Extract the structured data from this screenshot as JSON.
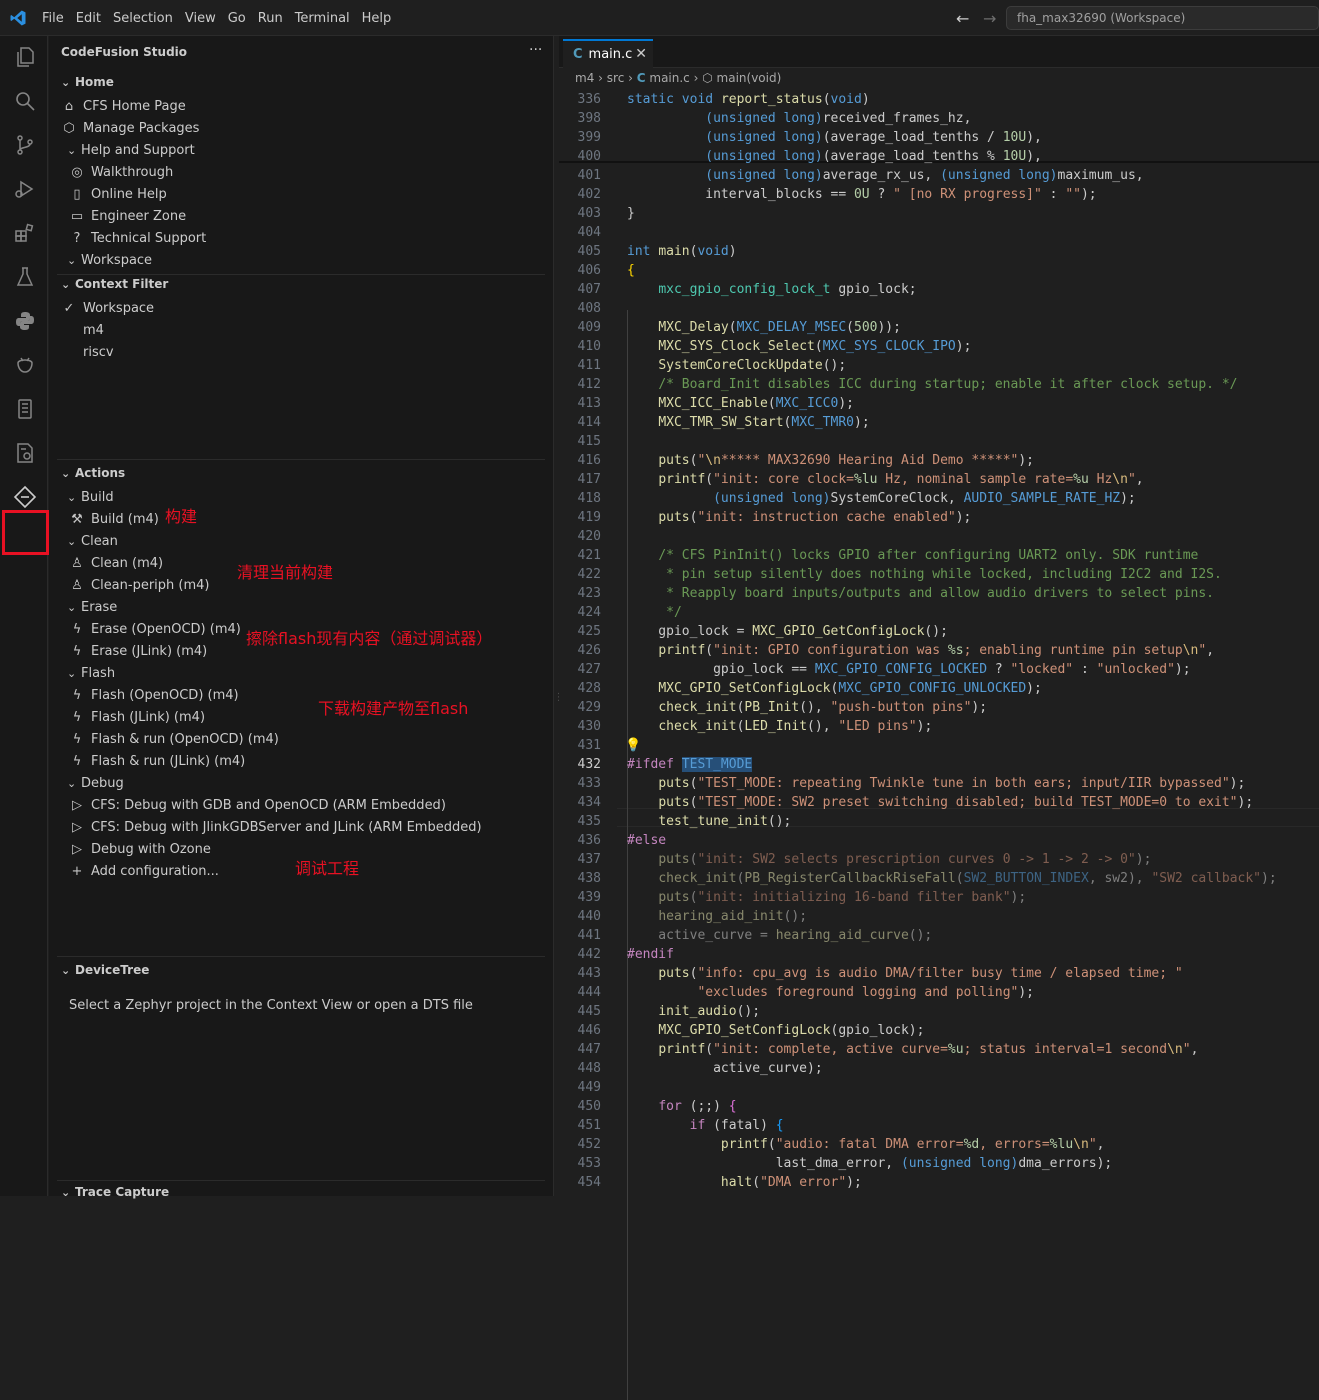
{
  "menu": [
    "File",
    "Edit",
    "Selection",
    "View",
    "Go",
    "Run",
    "Terminal",
    "Help"
  ],
  "workspace_search": "fha_max32690 (Workspace)",
  "sidebar": {
    "title": "CodeFusion Studio",
    "home_header": "Home",
    "home_items": [
      "CFS Home Page",
      "Manage Packages"
    ],
    "help_header": "Help and Support",
    "help_items": [
      "Walkthrough",
      "Online Help",
      "Engineer Zone",
      "Technical Support"
    ],
    "workspace_header": "Workspace",
    "context_header": "Context Filter",
    "context_items": [
      "Workspace",
      "m4",
      "riscv"
    ],
    "actions_header": "Actions",
    "build_header": "Build",
    "build_items": [
      "Build (m4)"
    ],
    "clean_header": "Clean",
    "clean_items": [
      "Clean (m4)",
      "Clean-periph (m4)"
    ],
    "erase_header": "Erase",
    "erase_items": [
      "Erase (OpenOCD) (m4)",
      "Erase (JLink) (m4)"
    ],
    "flash_header": "Flash",
    "flash_items": [
      "Flash (OpenOCD) (m4)",
      "Flash (JLink) (m4)",
      "Flash & run (OpenOCD) (m4)",
      "Flash & run (JLink) (m4)"
    ],
    "debug_header": "Debug",
    "debug_items": [
      "CFS: Debug with GDB and OpenOCD (ARM Embedded)",
      "CFS: Debug with JlinkGDBServer and JLink (ARM Embedded)",
      "Debug with Ozone"
    ],
    "add_config": "Add configuration...",
    "devicetree_header": "DeviceTree",
    "devicetree_msg": "Select a Zephyr project in the Context View or open a DTS file",
    "trace_header": "Trace Capture"
  },
  "annotations": {
    "build": "构建",
    "clean": "清理当前构建",
    "erase": "擦除flash现有内容（通过调试器）",
    "flash": "下载构建产物至flash",
    "debug": "调试工程"
  },
  "editor": {
    "tab_label": "main.c",
    "breadcrumb": [
      "m4",
      "src",
      "main.c",
      "main(void)"
    ],
    "sticky_line_number": "336",
    "current_line": "432",
    "line_numbers": [
      "398",
      "399",
      "400",
      "401",
      "402",
      "403",
      "404",
      "405",
      "406",
      "407",
      "408",
      "409",
      "410",
      "411",
      "412",
      "413",
      "414",
      "415",
      "416",
      "417",
      "418",
      "419",
      "420",
      "421",
      "422",
      "423",
      "424",
      "425",
      "426",
      "427",
      "428",
      "429",
      "430",
      "431",
      "432",
      "433",
      "434",
      "435",
      "436",
      "437",
      "438",
      "439",
      "440",
      "441",
      "442",
      "443",
      "444",
      "445",
      "446",
      "447",
      "448",
      "449",
      "450",
      "451",
      "452",
      "453",
      "454"
    ]
  },
  "colors": {
    "accent": "#0078d4",
    "highlight": "#e81123",
    "annotation": "#e81123"
  }
}
